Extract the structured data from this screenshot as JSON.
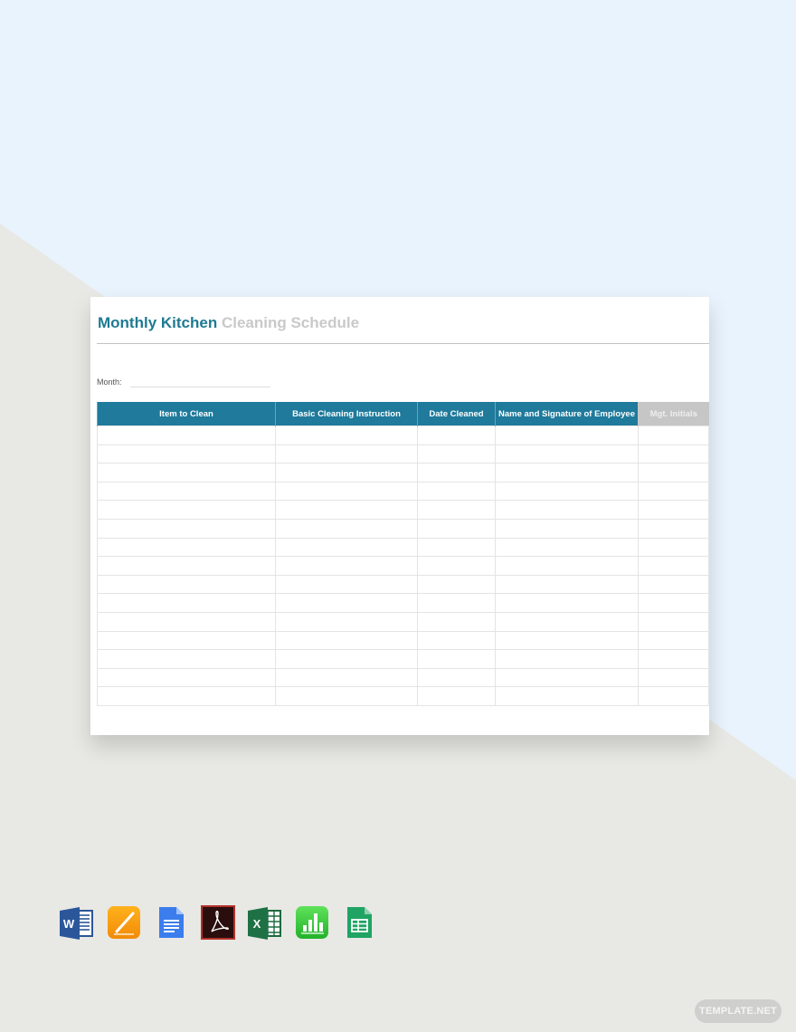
{
  "document": {
    "title_primary": "Monthly Kitchen",
    "title_secondary": "Cleaning Schedule",
    "month_label": "Month:",
    "month_value": "",
    "table": {
      "columns": [
        "Item to Clean",
        "Basic Cleaning Instruction",
        "Date Cleaned",
        "Name and Signature of Employee",
        "Mgt. Initials"
      ],
      "row_count": 15,
      "rows": [
        [
          "",
          "",
          "",
          "",
          ""
        ],
        [
          "",
          "",
          "",
          "",
          ""
        ],
        [
          "",
          "",
          "",
          "",
          ""
        ],
        [
          "",
          "",
          "",
          "",
          ""
        ],
        [
          "",
          "",
          "",
          "",
          ""
        ],
        [
          "",
          "",
          "",
          "",
          ""
        ],
        [
          "",
          "",
          "",
          "",
          ""
        ],
        [
          "",
          "",
          "",
          "",
          ""
        ],
        [
          "",
          "",
          "",
          "",
          ""
        ],
        [
          "",
          "",
          "",
          "",
          ""
        ],
        [
          "",
          "",
          "",
          "",
          ""
        ],
        [
          "",
          "",
          "",
          "",
          ""
        ],
        [
          "",
          "",
          "",
          "",
          ""
        ],
        [
          "",
          "",
          "",
          "",
          ""
        ],
        [
          "",
          "",
          "",
          "",
          ""
        ]
      ]
    }
  },
  "colors": {
    "accent": "#1f7a9b",
    "title_secondary": "#c9c9c9",
    "header_gray": "#c6c6c6",
    "background_blue": "#e8f3fd",
    "background_gray": "#e8e8e4"
  },
  "formats": [
    {
      "name": "Microsoft Word",
      "icon": "word-icon"
    },
    {
      "name": "Apple Pages",
      "icon": "pages-icon"
    },
    {
      "name": "Google Docs",
      "icon": "google-docs-icon"
    },
    {
      "name": "Adobe PDF",
      "icon": "pdf-icon"
    },
    {
      "name": "Microsoft Excel",
      "icon": "excel-icon"
    },
    {
      "name": "Apple Numbers",
      "icon": "numbers-icon"
    },
    {
      "name": "Google Sheets",
      "icon": "google-sheets-icon"
    }
  ],
  "watermark": "TEMPLATE.NET"
}
